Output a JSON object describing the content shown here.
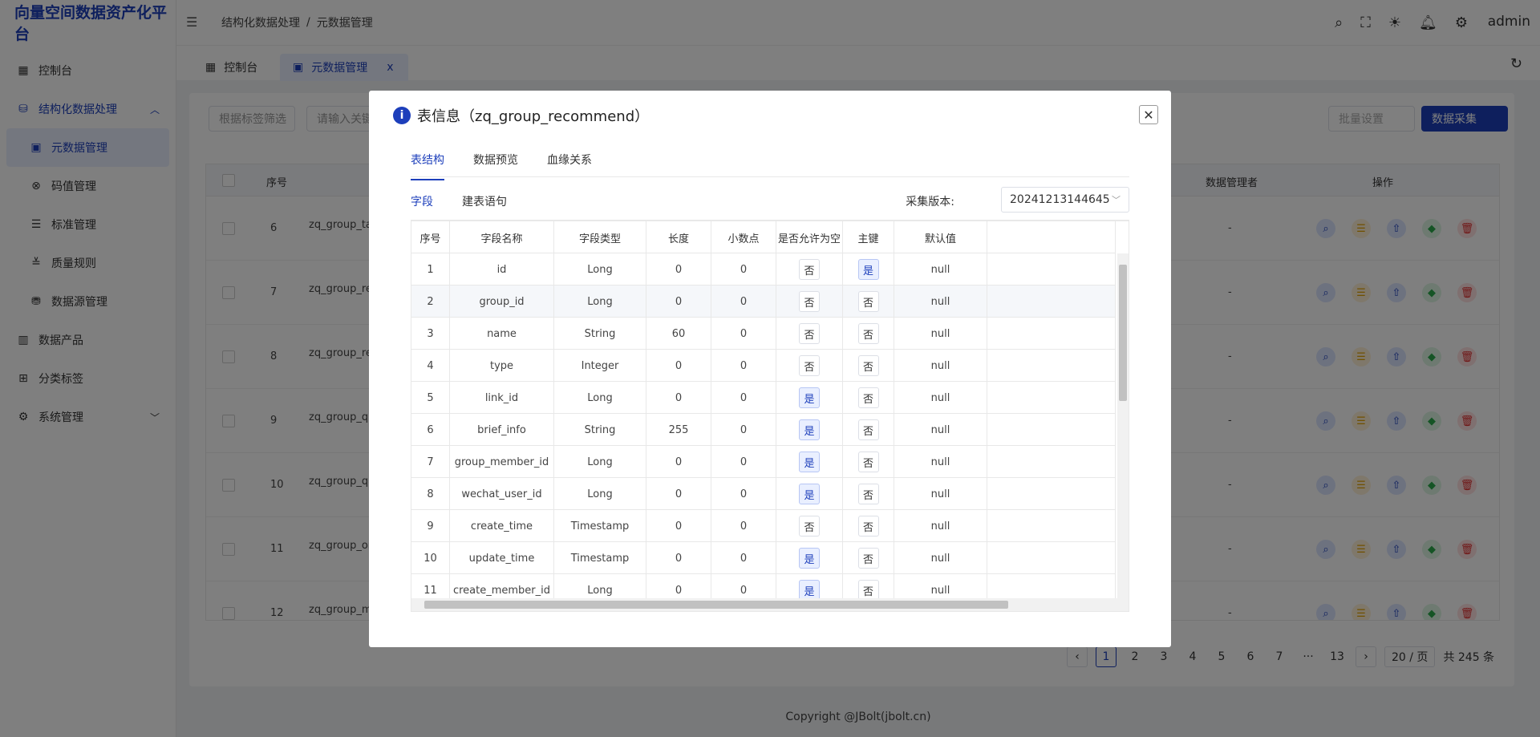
{
  "app": {
    "title": "向量空间数据资产化平台",
    "user": "admin"
  },
  "breadcrumb": {
    "level1": "结构化数据处理",
    "separator": "/",
    "level2": "元数据管理"
  },
  "sidebar": {
    "items": [
      {
        "label": "控制台",
        "icon": "dashboard-icon"
      },
      {
        "label": "结构化数据处理",
        "icon": "database-icon"
      },
      {
        "label": "元数据管理",
        "icon": "metadata-icon"
      },
      {
        "label": "码值管理",
        "icon": "code-icon"
      },
      {
        "label": "标准管理",
        "icon": "standard-icon"
      },
      {
        "label": "质量规则",
        "icon": "quality-icon"
      },
      {
        "label": "数据源管理",
        "icon": "datasource-icon"
      },
      {
        "label": "数据产品",
        "icon": "product-icon"
      },
      {
        "label": "分类标签",
        "icon": "tag-icon"
      },
      {
        "label": "系统管理",
        "icon": "system-icon"
      }
    ]
  },
  "tabs": [
    {
      "label": "控制台"
    },
    {
      "label": "元数据管理",
      "close": "x"
    }
  ],
  "toolbar": {
    "filter_tag": "根据标签筛选",
    "filter_keyword": "请输入关键",
    "batch": "批量设置",
    "collect": "数据采集"
  },
  "bg_table": {
    "headers": {
      "index": "序号",
      "manager": "数据管理者",
      "ops": "操作"
    },
    "rows": [
      {
        "no": "6",
        "name": "zq_group_tag",
        "manager": "-"
      },
      {
        "no": "7",
        "name": "zq_group_ref",
        "manager": "-"
      },
      {
        "no": "8",
        "name": "zq_group_rec",
        "manager": "-"
      },
      {
        "no": "9",
        "name": "zq_group_qu",
        "manager": "-"
      },
      {
        "no": "10",
        "name": "zq_group_qa",
        "manager": "-"
      },
      {
        "no": "11",
        "name": "zq_group_orc",
        "manager": "-"
      },
      {
        "no": "12",
        "name": "zq_group_me",
        "manager": "-"
      }
    ]
  },
  "pagination": {
    "pages": [
      "1",
      "2",
      "3",
      "4",
      "5",
      "6",
      "7",
      "···",
      "13"
    ],
    "page_size": "20 / 页",
    "total": "共 245 条"
  },
  "footer": "Copyright @JBolt(jbolt.cn)",
  "modal": {
    "title": "表信息（zq_group_recommend）",
    "tabs": [
      "表结构",
      "数据预览",
      "血缘关系"
    ],
    "subtabs": [
      "字段",
      "建表语句"
    ],
    "version_label": "采集版本:",
    "version_value": "20241213144645",
    "columns": [
      "序号",
      "字段名称",
      "字段类型",
      "长度",
      "小数点",
      "是否允许为空",
      "主键",
      "默认值"
    ],
    "rows": [
      {
        "no": "1",
        "name": "id",
        "type": "Long",
        "len": "0",
        "dec": "0",
        "nullable": "否",
        "pk": "是",
        "def": "null"
      },
      {
        "no": "2",
        "name": "group_id",
        "type": "Long",
        "len": "0",
        "dec": "0",
        "nullable": "否",
        "pk": "否",
        "def": "null"
      },
      {
        "no": "3",
        "name": "name",
        "type": "String",
        "len": "60",
        "dec": "0",
        "nullable": "否",
        "pk": "否",
        "def": "null"
      },
      {
        "no": "4",
        "name": "type",
        "type": "Integer",
        "len": "0",
        "dec": "0",
        "nullable": "否",
        "pk": "否",
        "def": "null"
      },
      {
        "no": "5",
        "name": "link_id",
        "type": "Long",
        "len": "0",
        "dec": "0",
        "nullable": "是",
        "pk": "否",
        "def": "null"
      },
      {
        "no": "6",
        "name": "brief_info",
        "type": "String",
        "len": "255",
        "dec": "0",
        "nullable": "是",
        "pk": "否",
        "def": "null"
      },
      {
        "no": "7",
        "name": "group_member_id",
        "type": "Long",
        "len": "0",
        "dec": "0",
        "nullable": "是",
        "pk": "否",
        "def": "null"
      },
      {
        "no": "8",
        "name": "wechat_user_id",
        "type": "Long",
        "len": "0",
        "dec": "0",
        "nullable": "是",
        "pk": "否",
        "def": "null"
      },
      {
        "no": "9",
        "name": "create_time",
        "type": "Timestamp",
        "len": "0",
        "dec": "0",
        "nullable": "否",
        "pk": "否",
        "def": "null"
      },
      {
        "no": "10",
        "name": "update_time",
        "type": "Timestamp",
        "len": "0",
        "dec": "0",
        "nullable": "是",
        "pk": "否",
        "def": "null"
      },
      {
        "no": "11",
        "name": "create_member_id",
        "type": "Long",
        "len": "0",
        "dec": "0",
        "nullable": "是",
        "pk": "否",
        "def": "null"
      }
    ]
  },
  "colors": {
    "accent": "#1d3fbb",
    "overlay": "rgba(0,0,0,0.5)"
  }
}
